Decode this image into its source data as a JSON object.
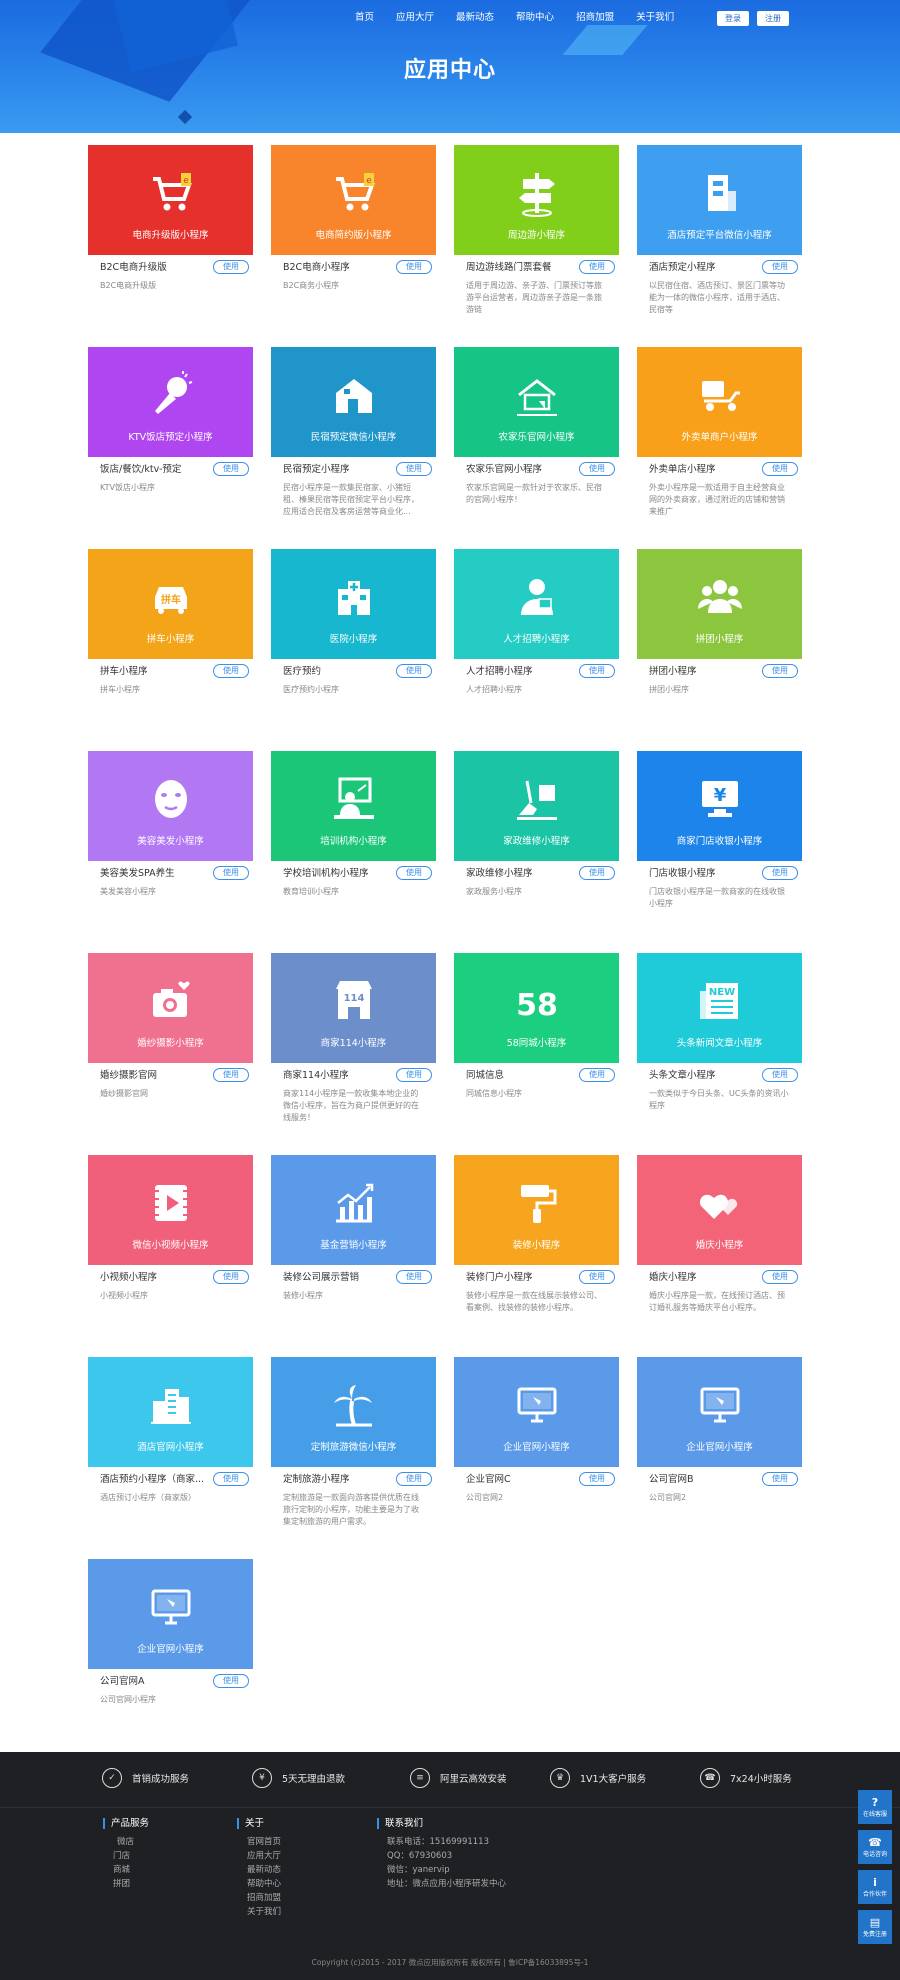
{
  "header": {
    "nav": [
      "首页",
      "应用大厅",
      "最新动态",
      "帮助中心",
      "招商加盟",
      "关于我们"
    ],
    "login": "登录",
    "register": "注册",
    "title": "应用中心"
  },
  "use_label": "使用",
  "cards": [
    {
      "tile": "电商升级版小程序",
      "name": "B2C电商升级版",
      "desc": "B2C电商升级版",
      "color": "#e5302c",
      "icon": "cart-icon"
    },
    {
      "tile": "电商简约版小程序",
      "name": "B2C电商小程序",
      "desc": "B2C商务小程序",
      "color": "#f8852b",
      "icon": "cart-icon"
    },
    {
      "tile": "周边游小程序",
      "name": "周边游线路门票套餐",
      "desc": "适用于周边游、亲子游、门票预订等旅游平台运营者，周边游亲子游是一条旅游链",
      "color": "#82cf1b",
      "icon": "signpost-icon"
    },
    {
      "tile": "酒店预定平台微信小程序",
      "name": "酒店预定小程序",
      "desc": "以民宿住宿、酒店预订、景区门票等功能为一体的微信小程序，适用于酒店、民宿等",
      "color": "#3e9ef0",
      "icon": "hotel-icon"
    },
    {
      "tile": "KTV饭店预定小程序",
      "name": "饭店/餐饮/ktv-预定",
      "desc": "KTV饭店小程序",
      "color": "#b046f0",
      "icon": "microphone-icon"
    },
    {
      "tile": "民宿预定微信小程序",
      "name": "民宿预定小程序",
      "desc": "民宿小程序是一款集民宿家、小猪短租、榛果民宿等民宿预定平台小程序，应用适合民宿及客房运营等商业化...",
      "color": "#1f95c9",
      "icon": "house-icon"
    },
    {
      "tile": "农家乐官网小程序",
      "name": "农家乐官网小程序",
      "desc": "农家乐官网是一款针对于农家乐、民宿的官网小程序！",
      "color": "#16c585",
      "icon": "farmhouse-icon"
    },
    {
      "tile": "外卖单商户小程序",
      "name": "外卖单店小程序",
      "desc": "外卖小程序是一款适用于自主经营商业网的外卖商家，通过附近的店铺和营销来推广",
      "color": "#f8a019",
      "icon": "delivery-icon"
    },
    {
      "tile": "拼车小程序",
      "name": "拼车小程序",
      "desc": "拼车小程序",
      "color": "#f4a419",
      "icon": "car-icon"
    },
    {
      "tile": "医院小程序",
      "name": "医疗预约",
      "desc": "医疗预约小程序",
      "color": "#17b7cf",
      "icon": "hospital-icon"
    },
    {
      "tile": "人才招聘小程序",
      "name": "人才招聘小程序",
      "desc": "人才招聘小程序",
      "color": "#24ccc4",
      "icon": "person-icon"
    },
    {
      "tile": "拼团小程序",
      "name": "拼团小程序",
      "desc": "拼团小程序",
      "color": "#8cc63e",
      "icon": "group-icon"
    },
    {
      "tile": "美容美发小程序",
      "name": "美容美发SPA养生",
      "desc": "美发美容小程序",
      "color": "#b277f2",
      "icon": "face-mask-icon"
    },
    {
      "tile": "培训机构小程序",
      "name": "学校培训机构小程序",
      "desc": "教育培训小程序",
      "color": "#1cc679",
      "icon": "teacher-icon"
    },
    {
      "tile": "家政维修小程序",
      "name": "家政维修小程序",
      "desc": "家政服务小程序",
      "color": "#1cc4a6",
      "icon": "broom-icon"
    },
    {
      "tile": "商家门店收银小程序",
      "name": "门店收银小程序",
      "desc": "门店收银小程序是一款商家的在线收银小程序",
      "color": "#1c84ea",
      "icon": "cashier-icon"
    },
    {
      "tile": "婚纱摄影小程序",
      "name": "婚纱摄影官网",
      "desc": "婚纱摄影官网",
      "color": "#f0708f",
      "icon": "camera-icon"
    },
    {
      "tile": "商家114小程序",
      "name": "商家114小程序",
      "desc": "商家114小程序是一款收集本地企业的微信小程序，旨在为商户提供更好的在线服务！",
      "color": "#6c8ecb",
      "icon": "store-icon"
    },
    {
      "tile": "58同城小程序",
      "name": "同城信息",
      "desc": "同城信息小程序",
      "color": "#1ccf80",
      "icon": "fifty-eight-icon"
    },
    {
      "tile": "头条新闻文章小程序",
      "name": "头条文章小程序",
      "desc": "一款类似于今日头条、UC头条的资讯小程序",
      "color": "#1fcbd9",
      "icon": "news-icon"
    },
    {
      "tile": "微信小视频小程序",
      "name": "小视频小程序",
      "desc": "小视频小程序",
      "color": "#f0607a",
      "icon": "video-icon"
    },
    {
      "tile": "基金营销小程序",
      "name": "装修公司展示营销",
      "desc": "装修小程序",
      "color": "#5a9ae9",
      "icon": "chart-icon"
    },
    {
      "tile": "装修小程序",
      "name": "装修门户小程序",
      "desc": "装修小程序是一款在线展示装修公司、看案例、找装修的装修小程序。",
      "color": "#f7a51e",
      "icon": "paint-roller-icon"
    },
    {
      "tile": "婚庆小程序",
      "name": "婚庆小程序",
      "desc": "婚庆小程序是一款，在线预订酒店、预订婚礼服务等婚庆平台小程序。",
      "color": "#f36478",
      "icon": "hearts-icon"
    },
    {
      "tile": "酒店官网小程序",
      "name": "酒店预约小程序（商家...",
      "desc": "酒店预订小程序（商家版）",
      "color": "#3ec7ec",
      "icon": "buildings-icon"
    },
    {
      "tile": "定制旅游微信小程序",
      "name": "定制旅游小程序",
      "desc": "定制旅游是一款面向游客提供优质在线旅行定制的小程序，功能主要是为了收集定制旅游的用户需求。",
      "color": "#479ee8",
      "icon": "palm-tree-icon"
    },
    {
      "tile": "企业官网小程序",
      "name": "企业官网C",
      "desc": "公司官网2",
      "color": "#5a9ae9",
      "icon": "monitor-icon"
    },
    {
      "tile": "企业官网小程序",
      "name": "公司官网B",
      "desc": "公司官网2",
      "color": "#5a9ae9",
      "icon": "monitor-icon"
    },
    {
      "tile": "企业官网小程序",
      "name": "公司官网A",
      "desc": "公司官网小程序",
      "color": "#5a9ae9",
      "icon": "monitor-icon"
    }
  ],
  "footer": {
    "features": [
      "首销成功服务",
      "5天无理由退款",
      "阿里云高效安装",
      "1V1大客户服务",
      "7x24小时服务"
    ],
    "feature_icons": [
      "shield-icon",
      "yen-icon",
      "server-icon",
      "vip-icon",
      "phone-icon"
    ],
    "columns": [
      {
        "title": "产品服务",
        "items": [
          "微店",
          "门店",
          "商城",
          "拼团"
        ]
      },
      {
        "title": "关于",
        "items": [
          "官网首页",
          "应用大厅",
          "最新动态",
          "帮助中心",
          "招商加盟",
          "关于我们"
        ]
      },
      {
        "title": "联系我们",
        "items": [
          "联系电话：15169991113",
          "QQ：67930603",
          "微信：yanervip",
          "地址：微点应用小程序研发中心"
        ]
      }
    ],
    "copyright": "Copyright (c)2015 - 2017 微点应用版权所有 版权所有 | 鲁ICP备16033895号-1"
  },
  "side": [
    {
      "label": "在线客服",
      "icon": "?"
    },
    {
      "label": "电话咨询",
      "icon": "☎"
    },
    {
      "label": "合作伙伴",
      "icon": "i"
    },
    {
      "label": "免费注册",
      "icon": "▤"
    }
  ]
}
